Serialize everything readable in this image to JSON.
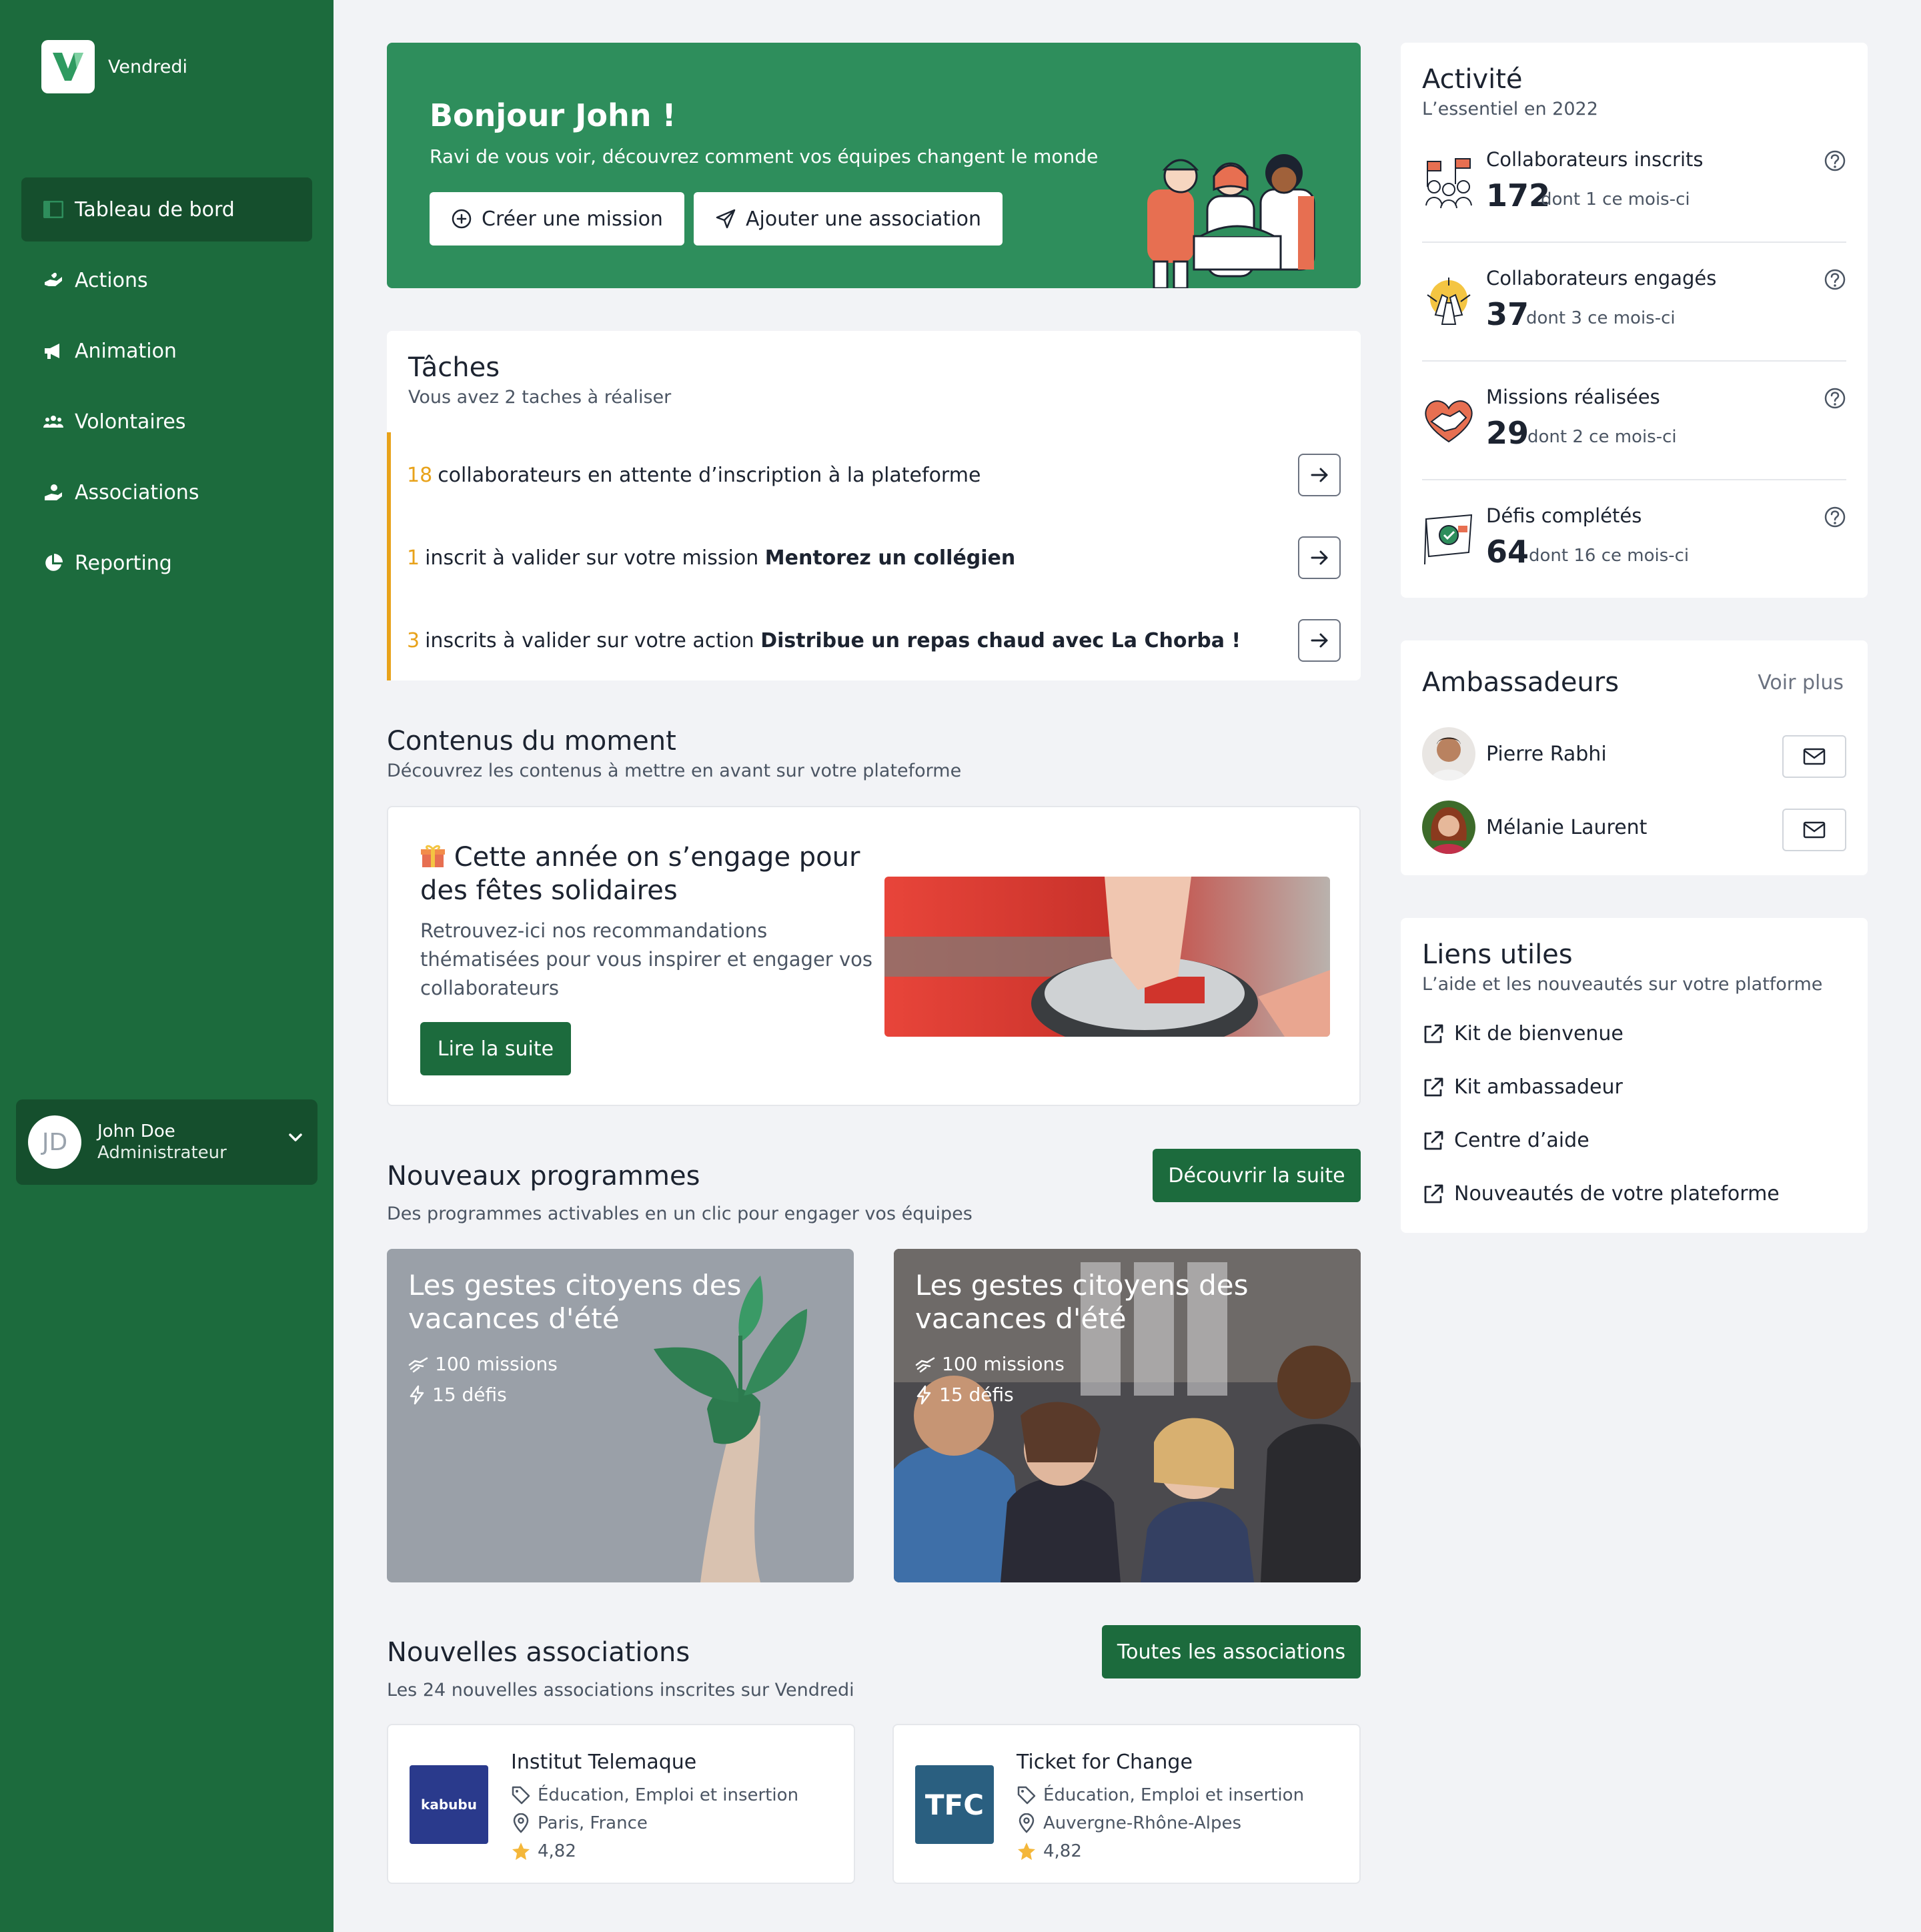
{
  "brand": {
    "name": "Vendredi"
  },
  "nav": [
    {
      "label": "Tableau de bord",
      "icon": "dashboard-icon",
      "active": true
    },
    {
      "label": "Actions",
      "icon": "hand-heart-icon"
    },
    {
      "label": "Animation",
      "icon": "megaphone-icon"
    },
    {
      "label": "Volontaires",
      "icon": "users-icon"
    },
    {
      "label": "Associations",
      "icon": "hand-user-icon"
    },
    {
      "label": "Reporting",
      "icon": "pie-chart-icon"
    }
  ],
  "user": {
    "initials": "JD",
    "name": "John Doe",
    "role": "Administrateur"
  },
  "hero": {
    "title": "Bonjour John !",
    "subtitle": "Ravi de vous voir, découvrez comment vos équipes changent le monde",
    "create_mission": "Créer une mission",
    "add_association": "Ajouter une association"
  },
  "tasks": {
    "title": "Tâches",
    "subtitle": "Vous avez 2 taches à réaliser",
    "items": [
      {
        "num": "18",
        "text": "collaborateurs en attente d’inscription à la plateforme",
        "bold": ""
      },
      {
        "num": "1",
        "text": "inscrit à valider sur votre mission",
        "bold": "Mentorez un collégien"
      },
      {
        "num": "3",
        "text": "inscrits à valider sur votre action",
        "bold": "Distribue un repas chaud avec La Chorba !"
      }
    ]
  },
  "contenus": {
    "title": "Contenus du moment",
    "subtitle": "Découvrez les contenus à mettre en avant sur votre plateforme",
    "card_title_line1": "Cette année on s’engage pour",
    "card_title_line2": "des fêtes solidaires",
    "card_body_line1": "Retrouvez-ici nos recommandations",
    "card_body_line2": "thématisées pour vous inspirer et engager vos",
    "card_body_line3": "collaborateurs",
    "read_more": "Lire la suite"
  },
  "programmes": {
    "title": "Nouveaux programmes",
    "subtitle": "Des programmes activables en un clic pour engager vos équipes",
    "discover": "Découvrir la suite",
    "items": [
      {
        "title": "Les gestes citoyens des vacances d'été",
        "missions": "100 missions",
        "defis": "15 défis"
      },
      {
        "title": "Les gestes citoyens des vacances d'été",
        "missions": "100 missions",
        "defis": "15 défis"
      }
    ]
  },
  "associations": {
    "title": "Nouvelles associations",
    "subtitle": "Les 24 nouvelles associations inscrites sur Vendredi",
    "all": "Toutes les associations",
    "items": [
      {
        "name": "Institut Telemaque",
        "logo_text": "kabubu",
        "tags": "Éducation, Emploi et insertion",
        "location": "Paris, France",
        "rating": "4,82",
        "logo_color": "#2a3a8c"
      },
      {
        "name": "Ticket for Change",
        "logo_text": "TFC",
        "tags": "Éducation, Emploi et insertion",
        "location": "Auvergne-Rhône-Alpes",
        "rating": "4,82",
        "logo_color": "#2a5f80"
      }
    ]
  },
  "activite": {
    "title": "Activité",
    "subtitle": "L’essentiel en 2022",
    "stats": [
      {
        "label": "Collaborateurs inscrits",
        "value": "172",
        "note": "dont 1 ce mois-ci",
        "icon": "flags-people-icon"
      },
      {
        "label": "Collaborateurs engagés",
        "value": "37",
        "note": "dont 3 ce mois-ci",
        "icon": "hands-together-icon"
      },
      {
        "label": "Missions réalisées",
        "value": "29",
        "note": "dont 2 ce mois-ci",
        "icon": "handshake-heart-icon"
      },
      {
        "label": "Défis complétés",
        "value": "64",
        "note": "dont 16 ce mois-ci",
        "icon": "check-flag-icon"
      }
    ]
  },
  "ambassadeurs": {
    "title": "Ambassadeurs",
    "more": "Voir plus",
    "items": [
      {
        "name": "Pierre Rabhi"
      },
      {
        "name": "Mélanie Laurent"
      }
    ]
  },
  "liens": {
    "title": "Liens utiles",
    "subtitle": "L’aide et les nouveautés sur votre platforme",
    "items": [
      {
        "label": "Kit de bienvenue"
      },
      {
        "label": "Kit ambassadeur"
      },
      {
        "label": "Centre d’aide"
      },
      {
        "label": "Nouveautés de votre plateforme"
      }
    ]
  },
  "colors": {
    "sidebar": "#1c6b3d",
    "hero": "#2e8e5c",
    "accent": "#e8a21a",
    "background": "#f2f3f6"
  }
}
